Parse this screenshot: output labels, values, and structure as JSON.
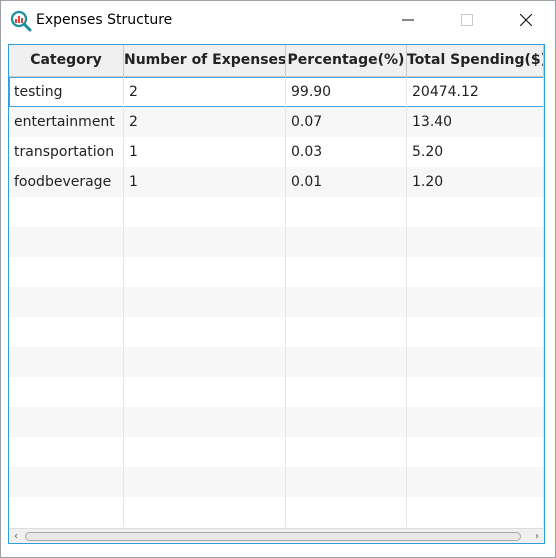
{
  "window": {
    "title": "Expenses Structure",
    "icon": "bar-chart-magnifier-icon",
    "controls": [
      "minimize-icon",
      "maximize-icon",
      "close-icon"
    ]
  },
  "table": {
    "columns": [
      "Category",
      "Number of Expenses",
      "Percentage(%)",
      "Total Spending($)"
    ],
    "rows": [
      [
        "testing",
        "2",
        "99.90",
        "20474.12"
      ],
      [
        "entertainment",
        "2",
        "0.07",
        "13.40"
      ],
      [
        "transportation",
        "1",
        "0.03",
        "5.20"
      ],
      [
        "foodbeverage",
        "1",
        "0.01",
        "1.20"
      ]
    ],
    "selected_row": 0,
    "empty_rows": 11
  },
  "scrollbar": {
    "left_arrow": "‹",
    "right_arrow": "›"
  },
  "colors": {
    "accent": "#2d9fd9",
    "icon_teal": "#1a8fa0",
    "icon_red": "#e0403a"
  }
}
